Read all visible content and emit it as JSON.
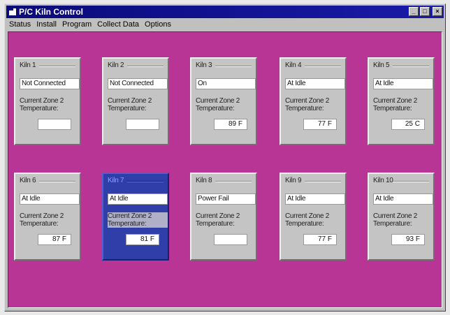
{
  "window": {
    "title": "P/C Kiln Control"
  },
  "menu": [
    "Status",
    "Install",
    "Program",
    "Collect Data",
    "Options"
  ],
  "caption": "Current Zone 2 Temperature:",
  "kilns": [
    {
      "label": "Kiln 1",
      "status": "Not Connected",
      "temp": ""
    },
    {
      "label": "Kiln 2",
      "status": "Not Connected",
      "temp": ""
    },
    {
      "label": "Kiln 3",
      "status": "On",
      "temp": "89 F"
    },
    {
      "label": "Kiln 4",
      "status": "At Idle",
      "temp": "77 F"
    },
    {
      "label": "Kiln 5",
      "status": "At Idle",
      "temp": "25 C"
    },
    {
      "label": "Kiln 6",
      "status": "At Idle",
      "temp": "87 F"
    },
    {
      "label": "Kiln 7",
      "status": "At Idle",
      "temp": "81 F"
    },
    {
      "label": "Kiln 8",
      "status": "Power Fail",
      "temp": ""
    },
    {
      "label": "Kiln 9",
      "status": "At Idle",
      "temp": "77 F"
    },
    {
      "label": "Kiln 10",
      "status": "At Idle",
      "temp": "93 F"
    }
  ],
  "colors": {
    "background": "#b83595",
    "titlebar": "#0a0a7a",
    "selected_panel": "#2f3ea8"
  }
}
